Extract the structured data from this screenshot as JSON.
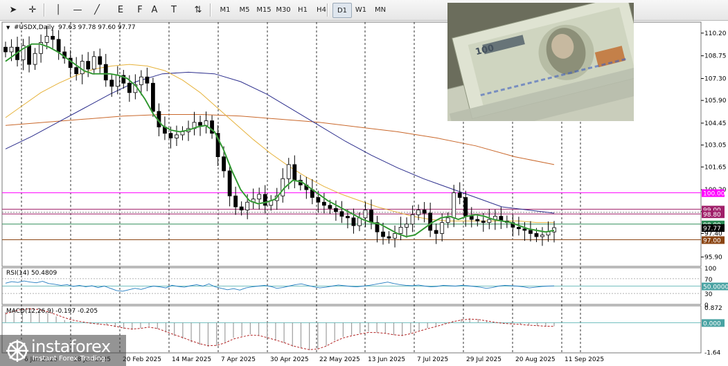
{
  "toolbar": {
    "tools": [
      "cursor-icon",
      "crosshair-icon",
      "vertical-line-icon",
      "horizontal-line-icon",
      "trendline-icon",
      "fibonacci-expansion-icon",
      "fibonacci-fan-icon",
      "text-icon",
      "text-label-icon",
      "arrows-icon"
    ],
    "tool_glyphs": [
      "➤",
      "✛",
      "│",
      "—",
      "╱",
      "E",
      "F",
      "A",
      "T",
      "⇅"
    ],
    "timeframes": [
      "M1",
      "M5",
      "M15",
      "M30",
      "H1",
      "H4",
      "D1",
      "W1",
      "MN"
    ],
    "active_timeframe": "D1"
  },
  "colors": {
    "ma_fast": "#1f8a1f",
    "ma_fast2": "#74c074",
    "ma_50": "#e6b23a",
    "ma_100": "#2b2d8c",
    "ma_200": "#c9672a",
    "magenta_line": "#ff00ff",
    "purple_line": "#a0206a",
    "green_level": "#2e8b57",
    "brown_level": "#8b4513",
    "rsi": "#1f7abf",
    "macd_hist": "#9e9e9e",
    "macd_signal": "#b22222"
  },
  "chart_data": [
    {
      "type": "candlestick",
      "title": "#USDX,Daily",
      "ohlc_label": "97.63 97.78 97.60 97.77",
      "y_ticks": [
        "110.20",
        "108.75",
        "107.30",
        "105.90",
        "104.45",
        "103.05",
        "101.65",
        "100.20",
        "98.80",
        "97.40",
        "95.90"
      ],
      "ylim": [
        95.3,
        110.9
      ],
      "x_labels": [
        "6 Jan 2025",
        "28 Jan 2025",
        "20 Feb 2025",
        "14 Mar 2025",
        "7 Apr 2025",
        "30 Apr 2025",
        "22 May 2025",
        "13 Jun 2025",
        "7 Jul 2025",
        "29 Jul 2025",
        "20 Aug 2025",
        "11 Sep 2025"
      ],
      "levels": [
        {
          "label": "100.00",
          "value": 100.0,
          "color": "#ff00ff"
        },
        {
          "label": "99.00",
          "value": 98.95,
          "color": "#a0206a"
        },
        {
          "label": "98.80",
          "value": 98.65,
          "color": "#a0206a"
        },
        {
          "label": "98.00",
          "value": 98.0,
          "color": "#2e8b57"
        },
        {
          "label": "97.77",
          "value": 97.77,
          "color": "#000000"
        },
        {
          "label": "97.00",
          "value": 97.0,
          "color": "#8b4513"
        }
      ],
      "close_path": [
        109.0,
        109.3,
        108.5,
        109.4,
        108.2,
        108.9,
        109.6,
        110.0,
        109.8,
        109.0,
        108.6,
        108.0,
        107.6,
        108.4,
        107.9,
        108.7,
        108.2,
        107.2,
        106.8,
        107.5,
        107.0,
        106.4,
        106.9,
        107.4,
        107.0,
        105.2,
        104.2,
        103.8,
        103.5,
        103.7,
        103.9,
        104.1,
        104.5,
        104.3,
        104.6,
        103.8,
        102.3,
        101.4,
        99.8,
        99.1,
        98.9,
        99.4,
        99.6,
        99.9,
        99.2,
        99.5,
        99.8,
        100.9,
        101.8,
        100.8,
        100.5,
        100.2,
        99.7,
        99.4,
        99.2,
        99.0,
        98.8,
        98.5,
        98.4,
        97.9,
        98.4,
        98.9,
        98.1,
        97.5,
        97.2,
        97.1,
        97.4,
        97.8,
        98.0,
        98.6,
        98.9,
        98.7,
        97.6,
        97.4,
        98.1,
        98.4,
        100.0,
        99.7,
        98.5,
        98.3,
        98.2,
        98.1,
        98.3,
        98.5,
        98.2,
        98.1,
        97.8,
        97.7,
        97.6,
        97.4,
        97.2,
        97.3,
        97.5,
        97.77
      ],
      "series": [
        {
          "name": "MA fast",
          "values": [
            108.4,
            108.8,
            109.2,
            109.5,
            109.5,
            109.3,
            109.0,
            108.6,
            108.2,
            107.8,
            107.6,
            107.6,
            107.6,
            107.5,
            107.3,
            106.8,
            106.0,
            105.0,
            104.3,
            104.0,
            103.9,
            104.0,
            104.2,
            104.3,
            103.9,
            102.8,
            101.4,
            100.2,
            99.5,
            99.3,
            99.4,
            99.6,
            100.3,
            100.8,
            100.7,
            100.3,
            99.9,
            99.5,
            99.2,
            98.9,
            98.6,
            98.3,
            98.1,
            98.0,
            97.7,
            97.4,
            97.2,
            97.3,
            97.7,
            98.1,
            98.4,
            98.5,
            98.3,
            98.5,
            98.6,
            98.5,
            98.3,
            98.2,
            98.1,
            97.9,
            97.7,
            97.6,
            97.5,
            97.6
          ]
        },
        {
          "name": "MA 50",
          "values": [
            104.8,
            105.6,
            106.4,
            107.0,
            107.5,
            107.9,
            108.1,
            108.2,
            108.1,
            107.8,
            107.2,
            106.4,
            105.4,
            104.4,
            103.4,
            102.5,
            101.7,
            101.0,
            100.4,
            99.9,
            99.5,
            99.1,
            98.8,
            98.5,
            98.3,
            98.2,
            98.2,
            98.2,
            98.2,
            98.2,
            98.1,
            98.1
          ]
        },
        {
          "name": "MA 100",
          "values": [
            102.8,
            103.6,
            104.5,
            105.4,
            106.3,
            107.1,
            107.6,
            107.7,
            107.6,
            107.1,
            106.3,
            105.3,
            104.3,
            103.3,
            102.4,
            101.6,
            100.9,
            100.3,
            99.7,
            99.1,
            98.9,
            98.7
          ]
        },
        {
          "name": "MA 200",
          "values": [
            104.3,
            104.5,
            104.7,
            104.9,
            105.0,
            105.0,
            104.9,
            104.7,
            104.5,
            104.2,
            103.9,
            103.5,
            103.0,
            102.3,
            101.8
          ]
        }
      ]
    },
    {
      "type": "line",
      "title": "RSI(14) 50.4809",
      "y_ticks": [
        "100",
        "70",
        "50.0000",
        "30",
        "0"
      ],
      "ylim": [
        0,
        100
      ],
      "levels": [
        70,
        50,
        30
      ],
      "values": [
        58,
        62,
        60,
        64,
        61,
        59,
        63,
        57,
        55,
        52,
        54,
        49,
        52,
        48,
        51,
        46,
        50,
        44,
        38,
        36,
        40,
        44,
        41,
        46,
        50,
        48,
        45,
        52,
        49,
        47,
        51,
        54,
        50,
        56,
        48,
        44,
        40,
        43,
        39,
        45,
        48,
        50,
        52,
        49,
        44,
        46,
        50,
        54,
        56,
        52,
        48,
        45,
        47,
        50,
        53,
        51,
        49,
        48,
        50,
        52,
        55,
        58,
        61,
        57,
        54,
        52,
        51,
        53,
        50,
        48,
        49,
        52,
        51,
        50,
        52,
        51,
        49,
        47,
        44,
        46,
        50,
        52,
        51,
        50,
        48,
        45,
        47,
        49,
        50,
        50.48
      ]
    },
    {
      "type": "bar",
      "title": "MACD(12,26,9) -0.197 -0.205",
      "y_ticks": [
        "0.872",
        "0.000",
        "-1.64"
      ],
      "ylim": [
        -1.7,
        0.95
      ],
      "values": [
        0.6,
        0.75,
        0.82,
        0.8,
        0.7,
        0.55,
        0.35,
        0.15,
        0.05,
        0.0,
        -0.05,
        -0.1,
        -0.15,
        -0.25,
        -0.35,
        -0.4,
        -0.3,
        -0.2,
        -0.35,
        -0.55,
        -0.75,
        -0.9,
        -1.1,
        -1.25,
        -1.35,
        -1.3,
        -1.1,
        -0.85,
        -0.75,
        -0.65,
        -0.7,
        -0.85,
        -1.0,
        -1.15,
        -1.35,
        -1.45,
        -1.55,
        -1.5,
        -1.3,
        -1.0,
        -0.8,
        -0.7,
        -0.6,
        -0.5,
        -0.55,
        -0.6,
        -0.7,
        -0.75,
        -0.6,
        -0.45,
        -0.3,
        -0.2,
        -0.05,
        0.1,
        0.2,
        0.25,
        0.2,
        0.1,
        0.0,
        -0.05,
        -0.08,
        -0.1,
        -0.15,
        -0.18,
        -0.2,
        -0.2
      ],
      "signal": [
        0.5,
        0.65,
        0.75,
        0.78,
        0.74,
        0.62,
        0.45,
        0.28,
        0.14,
        0.05,
        -0.02,
        -0.08,
        -0.12,
        -0.2,
        -0.3,
        -0.36,
        -0.32,
        -0.25,
        -0.33,
        -0.5,
        -0.68,
        -0.84,
        -1.02,
        -1.18,
        -1.3,
        -1.28,
        -1.14,
        -0.92,
        -0.8,
        -0.7,
        -0.72,
        -0.84,
        -0.98,
        -1.12,
        -1.3,
        -1.42,
        -1.52,
        -1.48,
        -1.32,
        -1.06,
        -0.86,
        -0.74,
        -0.64,
        -0.55,
        -0.56,
        -0.6,
        -0.68,
        -0.72,
        -0.62,
        -0.48,
        -0.34,
        -0.22,
        -0.08,
        0.05,
        0.15,
        0.2,
        0.18,
        0.1,
        0.02,
        -0.04,
        -0.07,
        -0.1,
        -0.14,
        -0.17,
        -0.2,
        -0.205
      ]
    }
  ],
  "watermark": {
    "brand": "instaforex",
    "tagline": "Instant Forex Trading"
  }
}
